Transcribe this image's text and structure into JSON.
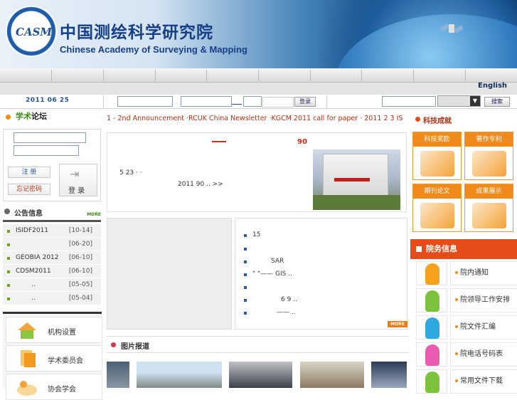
{
  "header": {
    "logo_text": "CASM",
    "title_cn": "中国测绘科学研究院",
    "title_en": "Chinese Academy of Surveying & Mapping"
  },
  "nav": {
    "english_link": "English"
  },
  "searchbar": {
    "date": "2011 06 25",
    "login_button": "登录",
    "search_button": "搜索"
  },
  "left": {
    "forum_tab_a": "学术",
    "forum_tab_b": "论坛",
    "register_button": "注 册",
    "forgot_button": "忘记密码",
    "login_button": "登 录",
    "notice_title": "公告信息",
    "more_label": "MORE",
    "notices": [
      {
        "title": "ISIDF2011",
        "date": "[10-14]"
      },
      {
        "title": "",
        "date": "[06-20]"
      },
      {
        "title": "GEOBIA 2012",
        "date": "[06-10]"
      },
      {
        "title": "CDSM2011",
        "date": "[06-10]"
      },
      {
        "title": "..",
        "date": "[05-05]"
      },
      {
        "title": "..",
        "date": "[05-04]"
      }
    ],
    "links": [
      "机构设置",
      "学术委员会",
      "协会学会"
    ]
  },
  "center": {
    "ticker": "1 - 2nd Announcement   ·RCUK China Newsletter   ·KGCM 2011 call for paper   ·   2011  2 3    IS",
    "headline_num": "90",
    "news_line1": "5 23                          ·                               ·",
    "news_line2": "2011     90         ..     >>",
    "list_items": [
      "15",
      "",
      "SAR",
      "\"        \"——  GIS ..",
      "",
      "6 9 ..",
      "——   .."
    ],
    "pics_title": "图片报道"
  },
  "right": {
    "tech_title": "科技成就",
    "tiles": [
      "科技奖励",
      "著作专利",
      "期刊论文",
      "成果展示"
    ],
    "office_title": "院务信息",
    "office_items": [
      "院内通知",
      "院领导工作安排",
      "院文件汇编",
      "院电话号码表",
      "常用文件下载"
    ]
  },
  "colors": {
    "accent_orange": "#f08a1a",
    "office_red": "#e64b1a",
    "brand_blue": "#173f86"
  }
}
